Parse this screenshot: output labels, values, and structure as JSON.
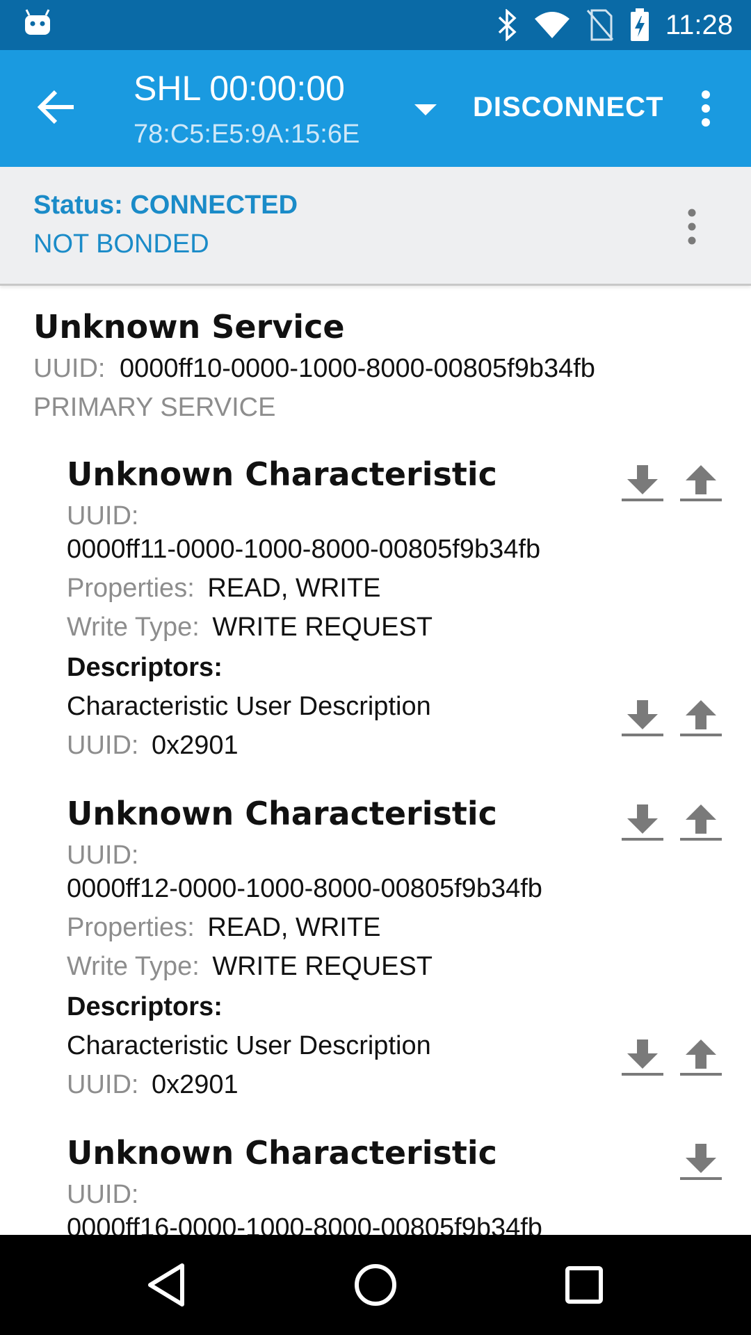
{
  "status_bar": {
    "time": "11:28",
    "icons": [
      "android-icon",
      "bluetooth-icon",
      "wifi-icon",
      "no-sim-icon",
      "battery-charging-icon"
    ]
  },
  "app_bar": {
    "title": "SHL 00:00:00",
    "subtitle": "78:C5:E5:9A:15:6E",
    "disconnect_label": "DISCONNECT",
    "color": "#1a9ae0"
  },
  "status_panel": {
    "status": "Status: CONNECTED",
    "bond": "NOT BONDED",
    "accent": "#1a8bc8"
  },
  "service": {
    "name": "Unknown Service",
    "uuid_label": "UUID:",
    "uuid": "0000ff10-0000-1000-8000-00805f9b34fb",
    "type": "PRIMARY SERVICE"
  },
  "characteristics": [
    {
      "name": "Unknown Characteristic",
      "uuid_label": "UUID:",
      "uuid": "0000ff11-0000-1000-8000-00805f9b34fb",
      "properties_label": "Properties:",
      "properties": "READ, WRITE",
      "write_type_label": "Write Type:",
      "write_type": "WRITE REQUEST",
      "descriptors_label": "Descriptors:",
      "descriptor_name": "Characteristic User Description",
      "descriptor_uuid_label": "UUID:",
      "descriptor_uuid": "0x2901"
    },
    {
      "name": "Unknown Characteristic",
      "uuid_label": "UUID:",
      "uuid": "0000ff12-0000-1000-8000-00805f9b34fb",
      "properties_label": "Properties:",
      "properties": "READ, WRITE",
      "write_type_label": "Write Type:",
      "write_type": "WRITE REQUEST",
      "descriptors_label": "Descriptors:",
      "descriptor_name": "Characteristic User Description",
      "descriptor_uuid_label": "UUID:",
      "descriptor_uuid": "0x2901"
    },
    {
      "name": "Unknown Characteristic",
      "uuid_label": "UUID:",
      "uuid": "0000ff16-0000-1000-8000-00805f9b34fb"
    }
  ],
  "nav_bar": {
    "buttons": [
      "back-nav-icon",
      "home-nav-icon",
      "recents-nav-icon"
    ]
  }
}
